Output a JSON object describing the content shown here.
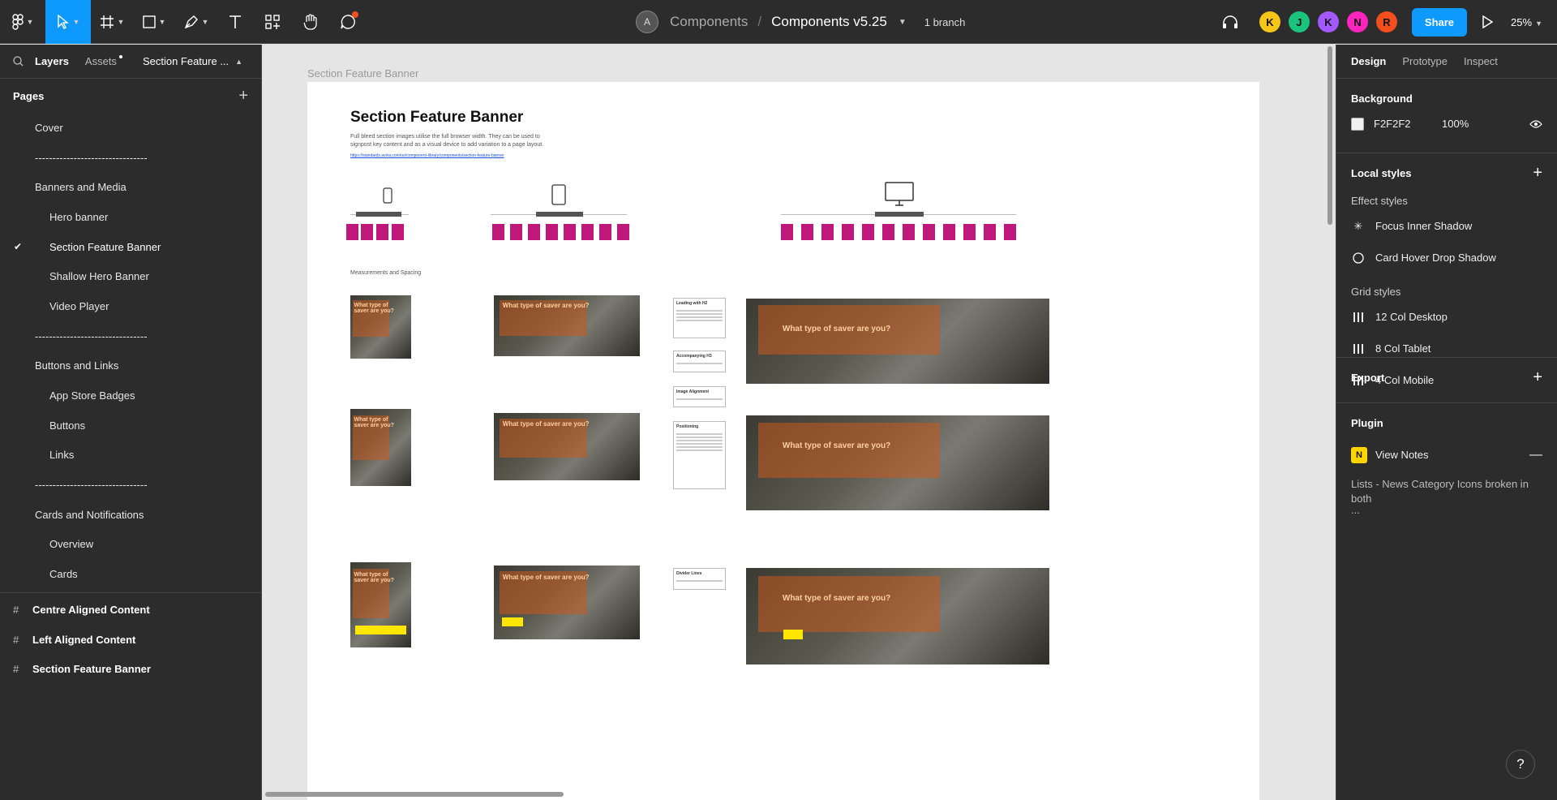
{
  "toolbar": {
    "team_initial": "A",
    "project": "Components",
    "separator": "/",
    "file_name": "Components v5.25",
    "branch_label": "1 branch",
    "avatars": [
      {
        "initial": "K",
        "color": "#f5c518"
      },
      {
        "initial": "J",
        "color": "#1bc47d"
      },
      {
        "initial": "K",
        "color": "#a259ff"
      },
      {
        "initial": "N",
        "color": "#ff24bd"
      },
      {
        "initial": "R",
        "color": "#f24e1e"
      }
    ],
    "share_label": "Share",
    "zoom_label": "25%"
  },
  "left_panel": {
    "tabs": {
      "layers": "Layers",
      "assets": "Assets",
      "page_menu": "Section Feature ..."
    },
    "pages_header": "Pages",
    "pages": [
      {
        "label": "Cover"
      },
      {
        "label": "--------------------------------"
      },
      {
        "label": "Banners and Media"
      },
      {
        "label": "Hero banner",
        "sub": true
      },
      {
        "label": "Section Feature Banner",
        "sub": true,
        "current": true
      },
      {
        "label": "Shallow Hero Banner",
        "sub": true
      },
      {
        "label": "Video Player",
        "sub": true
      },
      {
        "label": "--------------------------------"
      },
      {
        "label": "Buttons and Links"
      },
      {
        "label": "App Store Badges",
        "sub": true
      },
      {
        "label": "Buttons",
        "sub": true
      },
      {
        "label": "Links",
        "sub": true
      },
      {
        "label": "--------------------------------"
      },
      {
        "label": "Cards and Notifications"
      },
      {
        "label": "Overview",
        "sub": true
      },
      {
        "label": "Cards",
        "sub": true
      }
    ],
    "frames": [
      {
        "label": "Centre Aligned Content"
      },
      {
        "label": "Left Aligned Content"
      },
      {
        "label": "Section Feature Banner"
      }
    ]
  },
  "canvas": {
    "frame_label": "Section Feature Banner",
    "board_title": "Section Feature Banner",
    "board_desc": "Full bleed section images utilise the full browser width. They can be used to signpost key content and as a visual device to add variation to a page layout.",
    "board_link": "https://standards.aviva.com/uo/component-library/components/section-feature-banner",
    "measurements_label": "Measurements and Spacing",
    "banner_title": "What type of saver are you?",
    "notes": [
      "Leading with H2",
      "Accompanying H3",
      "Image Alignment",
      "Positioning",
      "Divider Lines"
    ]
  },
  "right_panel": {
    "tabs": {
      "design": "Design",
      "prototype": "Prototype",
      "inspect": "Inspect"
    },
    "background": {
      "title": "Background",
      "hex": "F2F2F2",
      "opacity": "100%"
    },
    "local_styles": {
      "title": "Local styles",
      "effect_title": "Effect styles",
      "effects": [
        "Focus Inner Shadow",
        "Card Hover Drop Shadow"
      ],
      "grid_title": "Grid styles",
      "grids": [
        "12 Col Desktop",
        "8 Col Tablet",
        "4 Col Mobile"
      ]
    },
    "export_title": "Export",
    "plugin": {
      "title": "Plugin",
      "badge": "N",
      "name": "View Notes",
      "note": "Lists - News Category Icons broken in both",
      "ellipsis": "..."
    }
  },
  "help_label": "?"
}
